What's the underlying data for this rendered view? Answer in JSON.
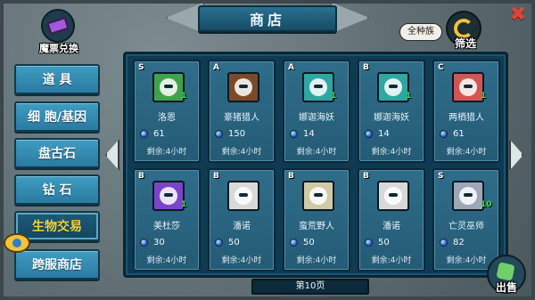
{
  "header": {
    "title": "商店"
  },
  "ticket": {
    "label": "魔票兑换"
  },
  "filter": {
    "tag": "全种族",
    "label": "筛选"
  },
  "menu": {
    "items": [
      {
        "label": "道 具"
      },
      {
        "label": "细 胞/基因"
      },
      {
        "label": "盘古石"
      },
      {
        "label": "钻 石"
      },
      {
        "label": "生物交易"
      },
      {
        "label": "跨服商店"
      }
    ],
    "active_index": 4
  },
  "cards": [
    {
      "rank": "S",
      "name": "洛恩",
      "price": "61",
      "remain": "剩余:4小时",
      "level": "1",
      "color": "#3fa34d",
      "icon": "dragon-portrait-icon"
    },
    {
      "rank": "A",
      "name": "豪猪猎人",
      "price": "150",
      "remain": "剩余:4小时",
      "level": "",
      "color": "#7a4a2b",
      "icon": "boar-portrait-icon"
    },
    {
      "rank": "A",
      "name": "娜迦海妖",
      "price": "14",
      "remain": "剩余:4小时",
      "level": "1",
      "color": "#2ea7a3",
      "icon": "naga-portrait-icon"
    },
    {
      "rank": "B",
      "name": "娜迦海妖",
      "price": "14",
      "remain": "剩余:4小时",
      "level": "1",
      "color": "#2ea7a3",
      "icon": "naga-portrait-icon"
    },
    {
      "rank": "C",
      "name": "两栖猎人",
      "price": "61",
      "remain": "剩余:4小时",
      "level": "1",
      "color": "#d45454",
      "icon": "amphibian-portrait-icon"
    },
    {
      "rank": "B",
      "name": "美杜莎",
      "price": "30",
      "remain": "剩余:4小时",
      "level": "1",
      "color": "#7a45c9",
      "icon": "medusa-portrait-icon"
    },
    {
      "rank": "B",
      "name": "潘诺",
      "price": "50",
      "remain": "剩余:4小时",
      "level": "",
      "color": "#d9d9d9",
      "icon": "skull-portrait-icon"
    },
    {
      "rank": "B",
      "name": "蛮荒野人",
      "price": "50",
      "remain": "剩余:4小时",
      "level": "",
      "color": "#cfc9a8",
      "icon": "savage-portrait-icon"
    },
    {
      "rank": "B",
      "name": "潘诺",
      "price": "50",
      "remain": "剩余:4小时",
      "level": "",
      "color": "#d9d9d9",
      "icon": "skull-portrait-icon"
    },
    {
      "rank": "S",
      "name": "亡灵巫师",
      "price": "82",
      "remain": "剩余:4小时",
      "level": "10",
      "color": "#9ea7b8",
      "icon": "necromancer-portrait-icon"
    }
  ],
  "page": {
    "label": "第10页"
  },
  "sell": {
    "label": "出售"
  },
  "colors": {
    "panel": "#0e3a52",
    "card": "#2f6d8a",
    "menu": "#3f9cc0",
    "menu_active_text": "#f3d23c",
    "level_text": "#3fe14a",
    "close": "#e0453a"
  }
}
